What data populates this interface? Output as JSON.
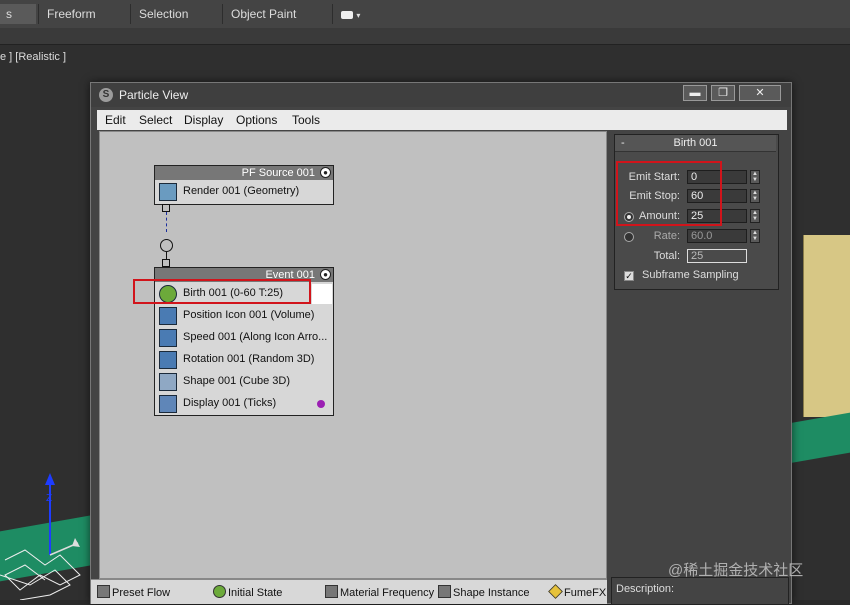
{
  "ribbon": {
    "tabs": [
      "s",
      "Freeform",
      "Selection",
      "Object Paint"
    ],
    "viewport_label": "e ] [Realistic ]"
  },
  "dialog": {
    "title": "Particle View",
    "window_buttons": [
      "▬",
      "❐",
      "✕"
    ],
    "menu": [
      "Edit",
      "Select",
      "Display",
      "Options",
      "Tools"
    ]
  },
  "graph": {
    "source_node": {
      "title": "PF Source 001",
      "operators": [
        {
          "label": "Render 001 (Geometry)",
          "icon": "render-icon"
        }
      ]
    },
    "event_node": {
      "title": "Event 001",
      "operators": [
        {
          "label": "Birth 001 (0-60 T:25)",
          "icon": "birth-icon"
        },
        {
          "label": "Position Icon 001 (Volume)",
          "icon": "position-icon"
        },
        {
          "label": "Speed 001 (Along Icon Arro...",
          "icon": "speed-icon"
        },
        {
          "label": "Rotation 001 (Random 3D)",
          "icon": "rotation-icon"
        },
        {
          "label": "Shape 001 (Cube 3D)",
          "icon": "shape-icon"
        },
        {
          "label": "Display 001 (Ticks)",
          "icon": "display-icon"
        }
      ]
    }
  },
  "panel": {
    "rollout_title": "Birth 001",
    "emit_start_label": "Emit Start:",
    "emit_start_value": "0",
    "emit_stop_label": "Emit Stop:",
    "emit_stop_value": "60",
    "amount_label": "Amount:",
    "amount_value": "25",
    "rate_label": "Rate:",
    "rate_value": "60.0",
    "total_label": "Total:",
    "total_value": "25",
    "subframe_label": "Subframe Sampling",
    "subframe_checked": true
  },
  "depot": {
    "items": [
      "Preset Flow",
      "Initial State",
      "Material Frequency",
      "Shape Instance",
      "FumeFX"
    ],
    "description_label": "Description:"
  },
  "watermark": "@稀土掘金技术社区",
  "colors": {
    "highlight_red": "#d1141b",
    "selection_blue": "#4a7bb3"
  }
}
